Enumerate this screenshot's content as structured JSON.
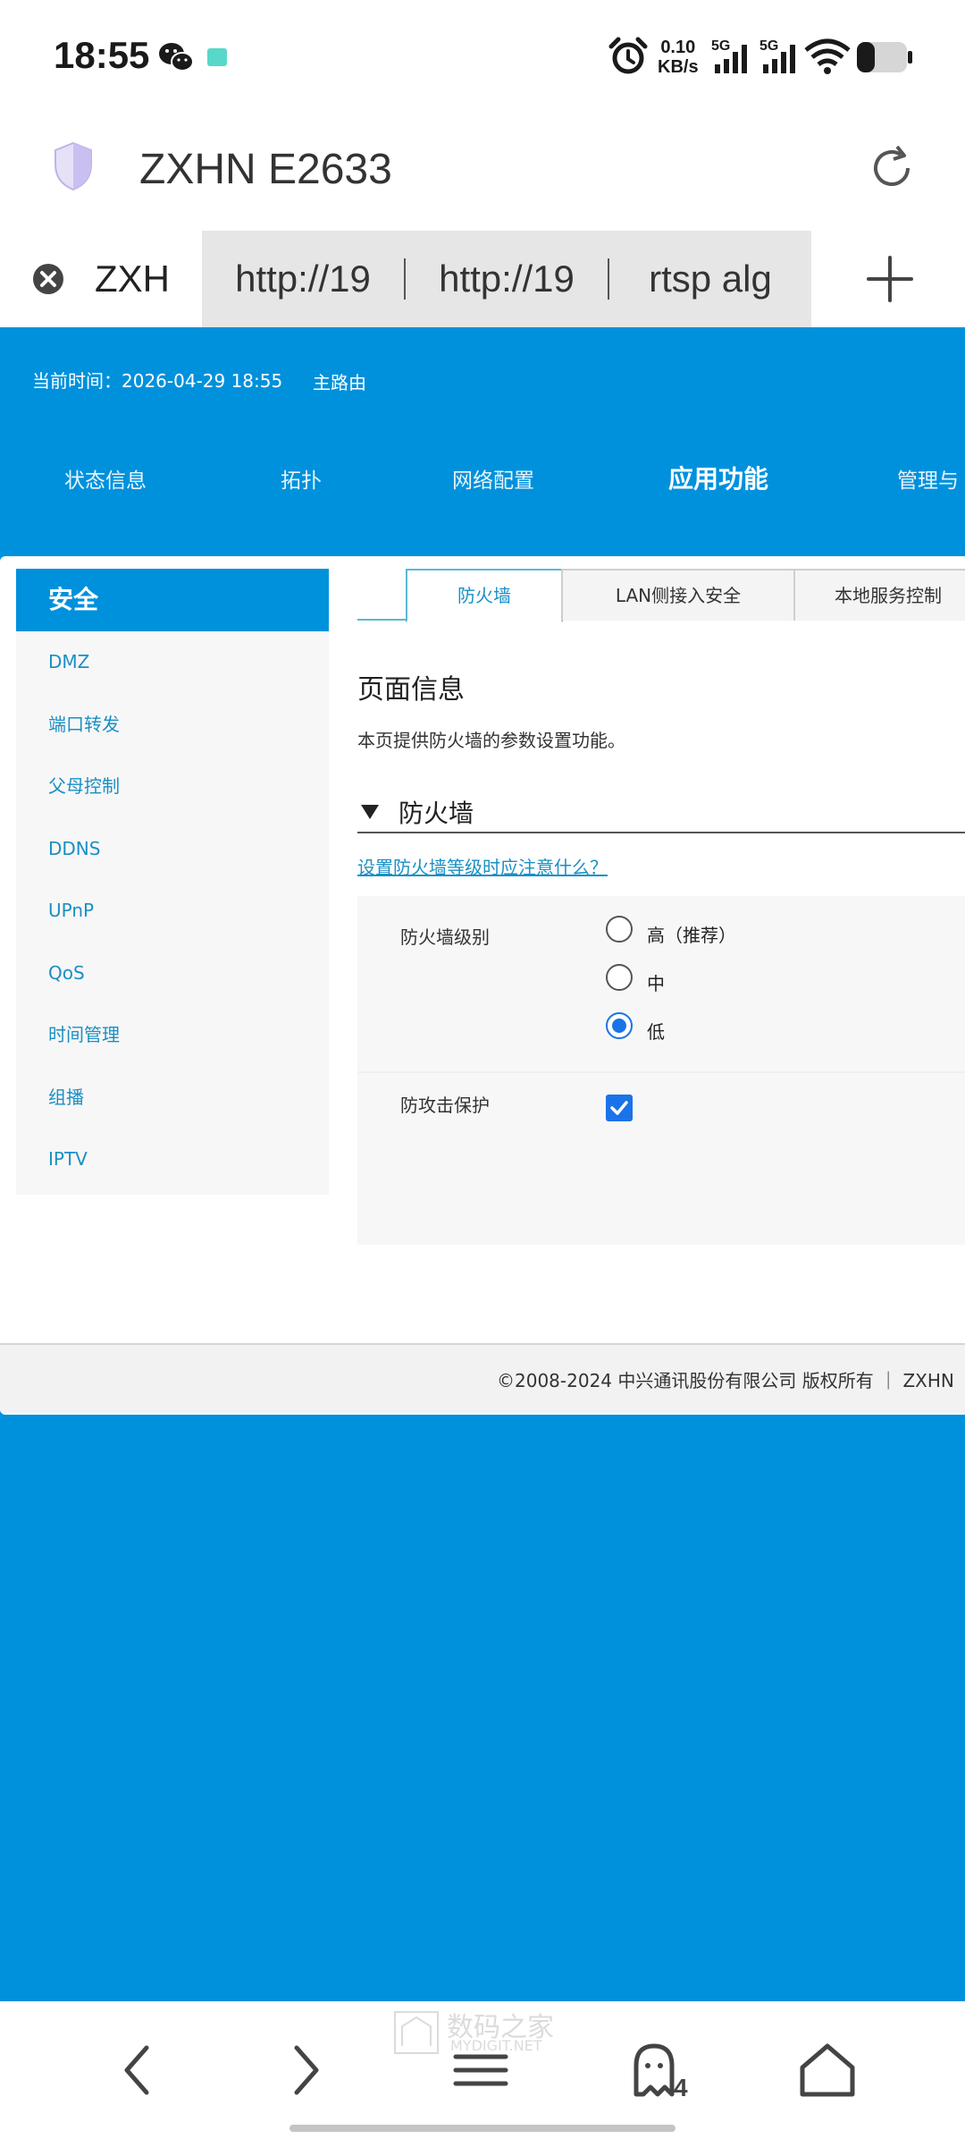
{
  "status_bar": {
    "time": "18:55",
    "net_speed_value": "0.10",
    "net_speed_unit": "KB/s",
    "signal1_label": "5G",
    "signal2_label": "5G",
    "icons": [
      "wechat-icon",
      "app-notification-icon",
      "alarm-icon",
      "signal-icon",
      "wifi-icon",
      "battery-icon"
    ]
  },
  "browser": {
    "title": "ZXHN E2633",
    "tabs": [
      {
        "label": "ZXH",
        "active": true
      },
      {
        "label": "http://19",
        "active": false
      },
      {
        "label": "http://19",
        "active": false
      },
      {
        "label": "rtsp alg",
        "active": false
      }
    ]
  },
  "router": {
    "current_time": "当前时间：2026-04-29 18:55",
    "router_role": "主路由",
    "nav": [
      "状态信息",
      "拓扑",
      "网络配置",
      "应用功能",
      "管理与"
    ],
    "nav_active": "应用功能",
    "sidebar": {
      "header": "安全",
      "items": [
        "DMZ",
        "端口转发",
        "父母控制",
        "DDNS",
        "UPnP",
        "QoS",
        "时间管理",
        "组播",
        "IPTV"
      ]
    },
    "subtabs": [
      "防火墙",
      "LAN侧接入安全",
      "本地服务控制"
    ],
    "page_info_title": "页面信息",
    "page_info_desc": "本页提供防火墙的参数设置功能。",
    "section_title": "防火墙",
    "help_link": "设置防火墙等级时应注意什么？",
    "firewall_level_label": "防火墙级别",
    "firewall_levels": [
      "高（推荐）",
      "中",
      "低"
    ],
    "firewall_level_selected": "低",
    "attack_protection_label": "防攻击保护",
    "attack_protection_checked": true,
    "footer": "©2008-2024 中兴通讯股份有限公司 版权所有 ｜ ZXHN"
  },
  "bottom_nav": {
    "tab_count": "4",
    "watermark_cn": "数码之家",
    "watermark_en": "MYDIGIT.NET"
  },
  "colors": {
    "router_blue": "#0091dc",
    "link": "#1a8fc4",
    "control_blue": "#1a73e8"
  }
}
